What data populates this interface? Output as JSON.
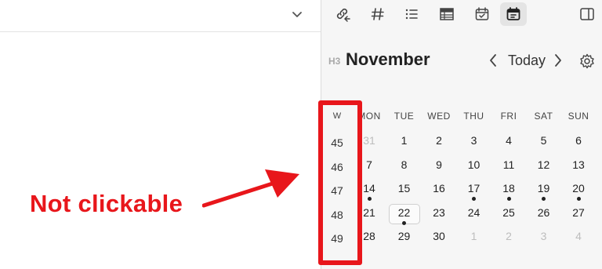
{
  "toolbar": {
    "icons": [
      "link-back-icon",
      "hashtag-icon",
      "list-icon",
      "table-icon",
      "calendar-check-icon",
      "calendar-note-icon",
      "sidebar-toggle-icon"
    ],
    "active": "calendar-note-icon"
  },
  "calendar": {
    "heading_tag": "H3",
    "month": "November",
    "today_label": "Today",
    "week_header": "W",
    "day_headers": [
      "MON",
      "TUE",
      "WED",
      "THU",
      "FRI",
      "SAT",
      "SUN"
    ],
    "weeks": [
      {
        "week": "45",
        "days": [
          {
            "d": "31",
            "muted": true,
            "dot": false
          },
          {
            "d": "1",
            "muted": false,
            "dot": false
          },
          {
            "d": "2",
            "muted": false,
            "dot": false
          },
          {
            "d": "3",
            "muted": false,
            "dot": false
          },
          {
            "d": "4",
            "muted": false,
            "dot": false
          },
          {
            "d": "5",
            "muted": false,
            "dot": false
          },
          {
            "d": "6",
            "muted": false,
            "dot": false
          }
        ]
      },
      {
        "week": "46",
        "days": [
          {
            "d": "7",
            "muted": false,
            "dot": false
          },
          {
            "d": "8",
            "muted": false,
            "dot": false
          },
          {
            "d": "9",
            "muted": false,
            "dot": false
          },
          {
            "d": "10",
            "muted": false,
            "dot": false
          },
          {
            "d": "11",
            "muted": false,
            "dot": false
          },
          {
            "d": "12",
            "muted": false,
            "dot": false
          },
          {
            "d": "13",
            "muted": false,
            "dot": false
          }
        ]
      },
      {
        "week": "47",
        "days": [
          {
            "d": "14",
            "muted": false,
            "dot": true
          },
          {
            "d": "15",
            "muted": false,
            "dot": false
          },
          {
            "d": "16",
            "muted": false,
            "dot": false
          },
          {
            "d": "17",
            "muted": false,
            "dot": true
          },
          {
            "d": "18",
            "muted": false,
            "dot": true
          },
          {
            "d": "19",
            "muted": false,
            "dot": true
          },
          {
            "d": "20",
            "muted": false,
            "dot": true
          }
        ]
      },
      {
        "week": "48",
        "days": [
          {
            "d": "21",
            "muted": false,
            "dot": false
          },
          {
            "d": "22",
            "muted": false,
            "dot": true,
            "today": true
          },
          {
            "d": "23",
            "muted": false,
            "dot": false
          },
          {
            "d": "24",
            "muted": false,
            "dot": false
          },
          {
            "d": "25",
            "muted": false,
            "dot": false
          },
          {
            "d": "26",
            "muted": false,
            "dot": false
          },
          {
            "d": "27",
            "muted": false,
            "dot": false
          }
        ]
      },
      {
        "week": "49",
        "days": [
          {
            "d": "28",
            "muted": false,
            "dot": false
          },
          {
            "d": "29",
            "muted": false,
            "dot": false
          },
          {
            "d": "30",
            "muted": false,
            "dot": false
          },
          {
            "d": "1",
            "muted": true,
            "dot": false
          },
          {
            "d": "2",
            "muted": true,
            "dot": false
          },
          {
            "d": "3",
            "muted": true,
            "dot": false
          },
          {
            "d": "4",
            "muted": true,
            "dot": false
          }
        ]
      }
    ]
  },
  "annotation": {
    "text": "Not clickable",
    "color": "#e8161b"
  }
}
